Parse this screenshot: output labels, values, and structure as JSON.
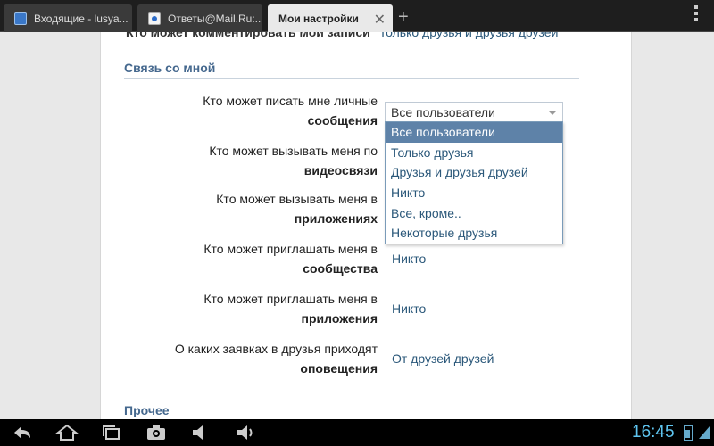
{
  "tabs": [
    {
      "label": "Входящие - lusya...",
      "icon": "mail-favicon"
    },
    {
      "label": "Ответы@Mail.Ru:...",
      "icon": "answers-favicon"
    },
    {
      "label": "Мои настройки",
      "icon": "none",
      "active": true
    }
  ],
  "page": {
    "clipped_text": "Кто может комментировать мои записи",
    "clipped_link": "Только друзья и друзья друзей",
    "section_title": "Связь со мной",
    "rows": [
      {
        "line1": "Кто может писать мне личные",
        "line2": "сообщения",
        "value": "Все пользователи"
      },
      {
        "line1": "Кто может вызывать меня по",
        "line2": "видеосвязи",
        "value": ""
      },
      {
        "line1": "Кто может вызывать меня в",
        "line2": "приложениях",
        "value": ""
      },
      {
        "line1": "Кто может приглашать меня в",
        "line2": "сообщества",
        "value": "Никто"
      },
      {
        "line1": "Кто может приглашать меня в",
        "line2": "приложения",
        "value": "Никто"
      },
      {
        "line1": "О каких заявках в друзья приходят",
        "line2": "оповещения",
        "value": "От друзей друзей"
      }
    ],
    "dropdown": {
      "selected": "Все пользователи",
      "options": [
        "Все пользователи",
        "Только друзья",
        "Друзья и друзья друзей",
        "Никто",
        "Все, кроме..",
        "Некоторые друзья"
      ]
    },
    "section2_title": "Прочее"
  },
  "system_bar": {
    "time": "16:45",
    "icons": [
      "back-icon",
      "home-icon",
      "recent-apps-icon",
      "camera-icon",
      "volume-down-icon",
      "volume-up-icon",
      "battery-icon",
      "wifi-icon"
    ]
  },
  "colors": {
    "accent_text": "#2b587a",
    "section_title": "#45688e",
    "selected_option": "#5e82a8",
    "clock": "#5fc5f0"
  }
}
